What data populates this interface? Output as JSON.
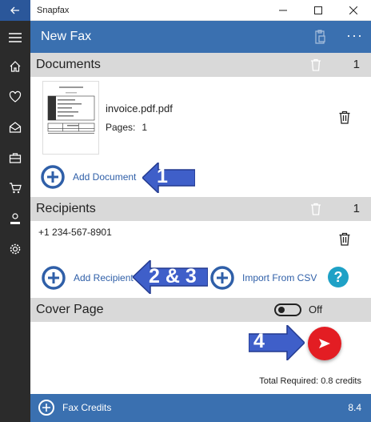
{
  "window": {
    "title": "Snapfax"
  },
  "appbar": {
    "title": "New Fax",
    "more": "···"
  },
  "documents": {
    "title": "Documents",
    "count": "1",
    "items": [
      {
        "name": "invoice.pdf.pdf",
        "pages_label": "Pages:",
        "pages": "1"
      }
    ],
    "add_label": "Add Document"
  },
  "recipients": {
    "title": "Recipients",
    "count": "1",
    "items": [
      {
        "number": "+1 234-567-8901"
      }
    ],
    "add_label": "Add Recipient",
    "import_label": "Import From CSV",
    "help": "?"
  },
  "cover_page": {
    "title": "Cover Page",
    "toggle_state": "Off"
  },
  "summary": {
    "total": "Total Required: 0.8 credits"
  },
  "footer": {
    "label": "Fax Credits",
    "value": "8.4"
  },
  "callouts": {
    "c1": "1",
    "c2": "2 & 3",
    "c3": "4"
  },
  "colors": {
    "accent": "#3a70b0",
    "sidebar": "#2b2b2b",
    "header_band": "#d9d9d9",
    "send": "#e31d23",
    "callout": "#3f5fc9",
    "link": "#2f5fa8"
  }
}
